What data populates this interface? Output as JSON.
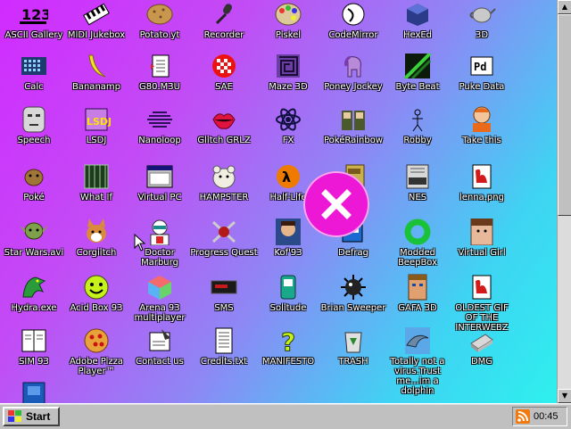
{
  "desktop": {
    "icons": [
      {
        "label": "ASCII Gallery",
        "icon": "ascii-123-icon"
      },
      {
        "label": "MIDI Jukebox",
        "icon": "piano-icon"
      },
      {
        "label": "Potato.yt",
        "icon": "potato-icon"
      },
      {
        "label": "Recorder",
        "icon": "microphone-icon"
      },
      {
        "label": "Piskel",
        "icon": "paint-palette-icon"
      },
      {
        "label": "CodeMirror",
        "icon": "code-editor-icon"
      },
      {
        "label": "HexEd",
        "icon": "cube-icon"
      },
      {
        "label": "3D",
        "icon": "teapot-icon"
      },
      {
        "label": "Calc",
        "icon": "calculator-icon"
      },
      {
        "label": "Bananamp",
        "icon": "banana-icon"
      },
      {
        "label": "G80.M3U",
        "icon": "playlist-icon"
      },
      {
        "label": "SAE",
        "icon": "amiga-ball-icon"
      },
      {
        "label": "Maze 3D",
        "icon": "maze-icon"
      },
      {
        "label": "Poney Jockey",
        "icon": "pony-icon"
      },
      {
        "label": "Byte Beat",
        "icon": "bytebeat-icon"
      },
      {
        "label": "Puke Data",
        "icon": "pd-icon"
      },
      {
        "label": "Speech",
        "icon": "face-icon"
      },
      {
        "label": "LSDJ",
        "icon": "lsdj-icon"
      },
      {
        "label": "Nanoloop",
        "icon": "waveform-icon"
      },
      {
        "label": "Glitch GRLZ",
        "icon": "lips-icon"
      },
      {
        "label": "FX",
        "icon": "atom-icon"
      },
      {
        "label": "PokéRainbow",
        "icon": "characters-icon"
      },
      {
        "label": "Robby",
        "icon": "stick-figure-icon"
      },
      {
        "label": "Take this",
        "icon": "cartoon-man-icon"
      },
      {
        "label": "Poké",
        "icon": "pokemon-icon"
      },
      {
        "label": "What If",
        "icon": "building-icon"
      },
      {
        "label": "Virtual PC",
        "icon": "window-icon"
      },
      {
        "label": "HAMPSTER",
        "icon": "hamster-icon"
      },
      {
        "label": "Half-Life",
        "icon": "half-life-icon"
      },
      {
        "label": "",
        "icon": "book-icon"
      },
      {
        "label": "NES",
        "icon": "nes-console-icon"
      },
      {
        "label": "lenna.png",
        "icon": "image-file-icon"
      },
      {
        "label": "Star Wars.avi",
        "icon": "yoda-icon"
      },
      {
        "label": "Corgiitch",
        "icon": "corgi-icon"
      },
      {
        "label": "Doctor Marburg",
        "icon": "doctor-icon"
      },
      {
        "label": "Progress Quest",
        "icon": "swords-icon"
      },
      {
        "label": "Kof'93",
        "icon": "fighter-icon"
      },
      {
        "label": "Defrag",
        "icon": "defrag-icon"
      },
      {
        "label": "Modded BeepBox",
        "icon": "green-ring-icon"
      },
      {
        "label": "Virtual Girl",
        "icon": "girl-face-icon"
      },
      {
        "label": "Hydra.exe",
        "icon": "dragon-icon"
      },
      {
        "label": "Acid Box 93",
        "icon": "smiley-icon"
      },
      {
        "label": "Arena 93 multiplayer",
        "icon": "colored-cube-icon"
      },
      {
        "label": "SMS",
        "icon": "sega-master-system-icon"
      },
      {
        "label": "Solitude",
        "icon": "solitude-icon"
      },
      {
        "label": "Brian Sweeper",
        "icon": "mine-icon"
      },
      {
        "label": "GAFA 3D",
        "icon": "wolfenstein-face-icon"
      },
      {
        "label": "OLDEST GIF OF THE INTERWEBZ",
        "icon": "gif-file-icon"
      },
      {
        "label": "SIM 93",
        "icon": "sim-book-icon"
      },
      {
        "label": "Adobe Pizza Player™",
        "icon": "pizza-icon"
      },
      {
        "label": "Contact us",
        "icon": "contact-note-icon"
      },
      {
        "label": "Credits.txt",
        "icon": "text-file-icon"
      },
      {
        "label": "MANIFESTO",
        "icon": "question-mark-icon"
      },
      {
        "label": "TRASH",
        "icon": "recycle-bin-icon"
      },
      {
        "label": "Totally not a virus.Trust me...im a dolphin",
        "icon": "dolphin-icon"
      },
      {
        "label": "DMG",
        "icon": "disk-image-icon"
      },
      {
        "label": "",
        "icon": "blue-box-icon"
      }
    ]
  },
  "taskbar": {
    "start_label": "Start",
    "clock": "00:45"
  },
  "colors": {
    "bg_left": "#d12bff",
    "bg_right": "#2ef0ee",
    "close_badge": "#ec18d6",
    "taskbar": "#c0c0c0"
  }
}
